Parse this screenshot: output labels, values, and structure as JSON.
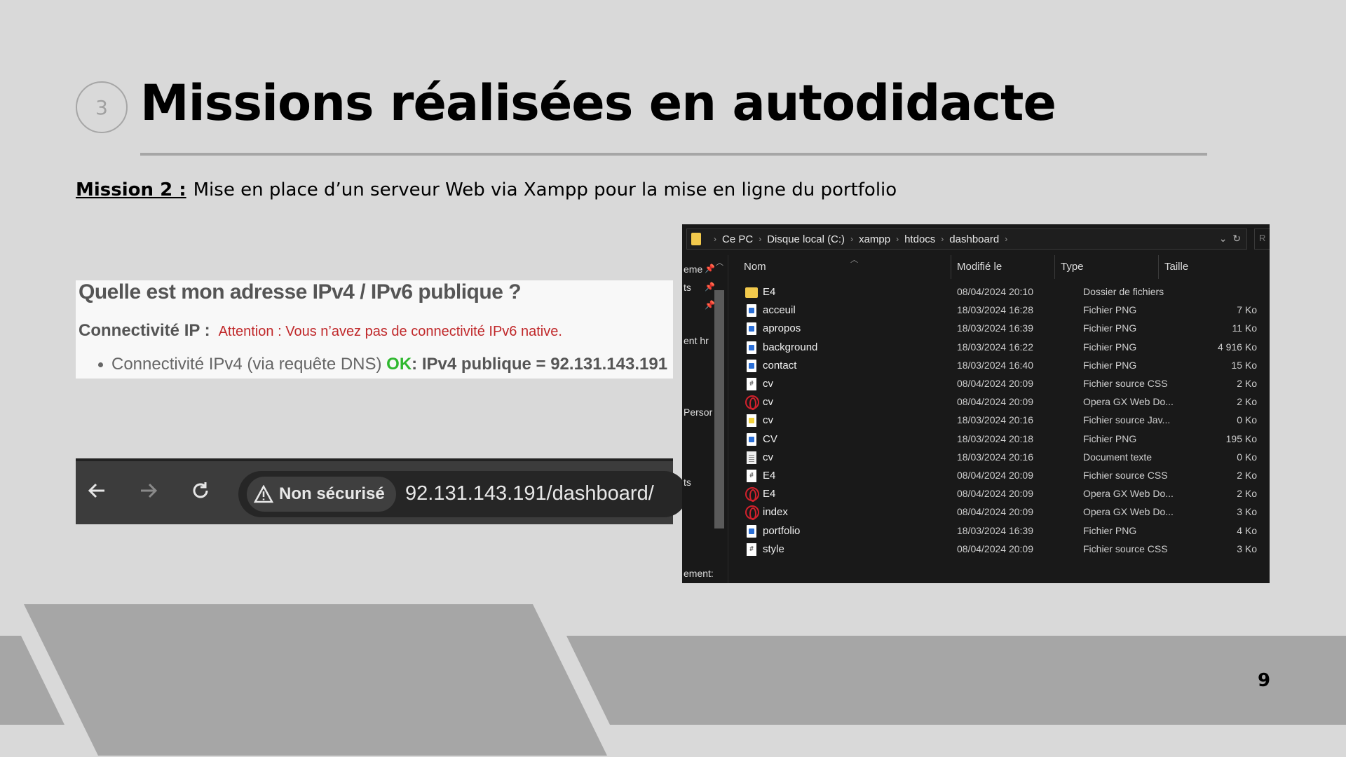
{
  "slide": {
    "section_number": "3",
    "title": "Missions réalisées en autodidacte",
    "mission_label": "Mission 2 :",
    "mission_text": "Mise en place d’un serveur Web via Xampp pour la mise en ligne du portfolio",
    "page_number": "9"
  },
  "ip_check": {
    "heading": "Quelle est mon adresse IPv4 / IPv6 publique ?",
    "connectivity_label": "Connectivité IP :",
    "warning": "Attention : Vous n’avez pas de connectivité IPv6 native.",
    "ipv4_line": "Connectivité IPv4 (via requête DNS)",
    "ok": "OK",
    "public_ip": ": IPv4 publique = 92.131.143.191"
  },
  "browser": {
    "security_label": "Non sécurisé",
    "url": "92.131.143.191/dashboard/"
  },
  "explorer": {
    "breadcrumb": [
      "Ce PC",
      "Disque local (C:)",
      "xampp",
      "htdocs",
      "dashboard"
    ],
    "search_placeholder": "R",
    "nav_items": [
      "eme",
      "ts",
      "ent hr",
      "Persor",
      "ts",
      "ement:"
    ],
    "columns": {
      "name": "Nom",
      "modified": "Modifié le",
      "type": "Type",
      "size": "Taille"
    },
    "files": [
      {
        "icon": "folder-icon",
        "name": "E4",
        "modified": "08/04/2024 20:10",
        "type": "Dossier de fichiers",
        "size": ""
      },
      {
        "icon": "png-file-icon",
        "name": "acceuil",
        "modified": "18/03/2024 16:28",
        "type": "Fichier PNG",
        "size": "7 Ko"
      },
      {
        "icon": "png-file-icon",
        "name": "apropos",
        "modified": "18/03/2024 16:39",
        "type": "Fichier PNG",
        "size": "11 Ko"
      },
      {
        "icon": "png-file-icon",
        "name": "background",
        "modified": "18/03/2024 16:22",
        "type": "Fichier PNG",
        "size": "4 916 Ko"
      },
      {
        "icon": "png-file-icon",
        "name": "contact",
        "modified": "18/03/2024 16:40",
        "type": "Fichier PNG",
        "size": "15 Ko"
      },
      {
        "icon": "css-file-icon",
        "name": "cv",
        "modified": "08/04/2024 20:09",
        "type": "Fichier source CSS",
        "size": "2 Ko"
      },
      {
        "icon": "opera-gx-icon",
        "name": "cv",
        "modified": "08/04/2024 20:09",
        "type": "Opera GX Web Do...",
        "size": "2 Ko"
      },
      {
        "icon": "js-file-icon",
        "name": "cv",
        "modified": "18/03/2024 20:16",
        "type": "Fichier source Jav...",
        "size": "0 Ko"
      },
      {
        "icon": "png-file-icon",
        "name": "CV",
        "modified": "18/03/2024 20:18",
        "type": "Fichier PNG",
        "size": "195 Ko"
      },
      {
        "icon": "text-file-icon",
        "name": "cv",
        "modified": "18/03/2024 20:16",
        "type": "Document texte",
        "size": "0 Ko"
      },
      {
        "icon": "css-file-icon",
        "name": "E4",
        "modified": "08/04/2024 20:09",
        "type": "Fichier source CSS",
        "size": "2 Ko"
      },
      {
        "icon": "opera-gx-icon",
        "name": "E4",
        "modified": "08/04/2024 20:09",
        "type": "Opera GX Web Do...",
        "size": "2 Ko"
      },
      {
        "icon": "opera-gx-icon",
        "name": "index",
        "modified": "08/04/2024 20:09",
        "type": "Opera GX Web Do...",
        "size": "3 Ko"
      },
      {
        "icon": "png-file-icon",
        "name": "portfolio",
        "modified": "18/03/2024 16:39",
        "type": "Fichier PNG",
        "size": "4 Ko"
      },
      {
        "icon": "css-file-icon",
        "name": "style",
        "modified": "08/04/2024 20:09",
        "type": "Fichier source CSS",
        "size": "3 Ko"
      }
    ]
  },
  "colors": {
    "background": "#d9d9d9",
    "band": "#a6a6a6",
    "ok_green": "#2fb82f",
    "warning_red": "#c0282a",
    "explorer_bg": "#191919"
  }
}
